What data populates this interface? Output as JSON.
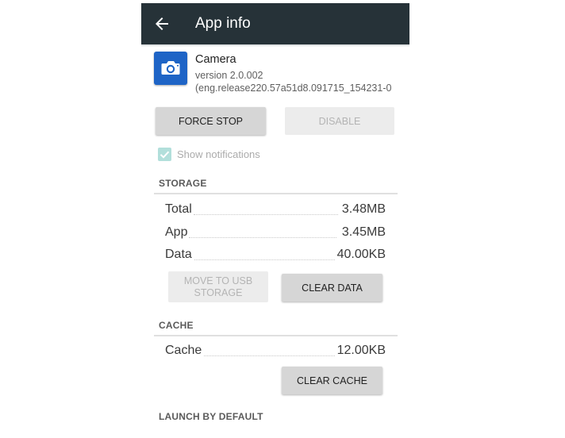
{
  "appbar": {
    "title": "App info",
    "back_icon": "arrow-back-icon",
    "background": "#263238"
  },
  "app": {
    "name": "Camera",
    "version": "version 2.0.002",
    "build": "(eng.release220.57a51d8.091715_154231-0",
    "icon": "camera-icon",
    "icon_color": "#1e64c6"
  },
  "actions": {
    "force_stop": "FORCE STOP",
    "disable": "DISABLE"
  },
  "notifications": {
    "label": "Show notifications",
    "checked": true
  },
  "storage": {
    "heading": "STORAGE",
    "rows": [
      {
        "label": "Total",
        "value": "3.48MB"
      },
      {
        "label": "App",
        "value": "3.45MB"
      },
      {
        "label": "Data",
        "value": "40.00KB"
      }
    ],
    "move_usb_line1": "MOVE TO USB",
    "move_usb_line2": "STORAGE",
    "clear_data": "CLEAR DATA"
  },
  "cache": {
    "heading": "CACHE",
    "rows": [
      {
        "label": "Cache",
        "value": "12.00KB"
      }
    ],
    "clear_cache": "CLEAR CACHE"
  },
  "launch": {
    "heading": "LAUNCH BY DEFAULT"
  }
}
